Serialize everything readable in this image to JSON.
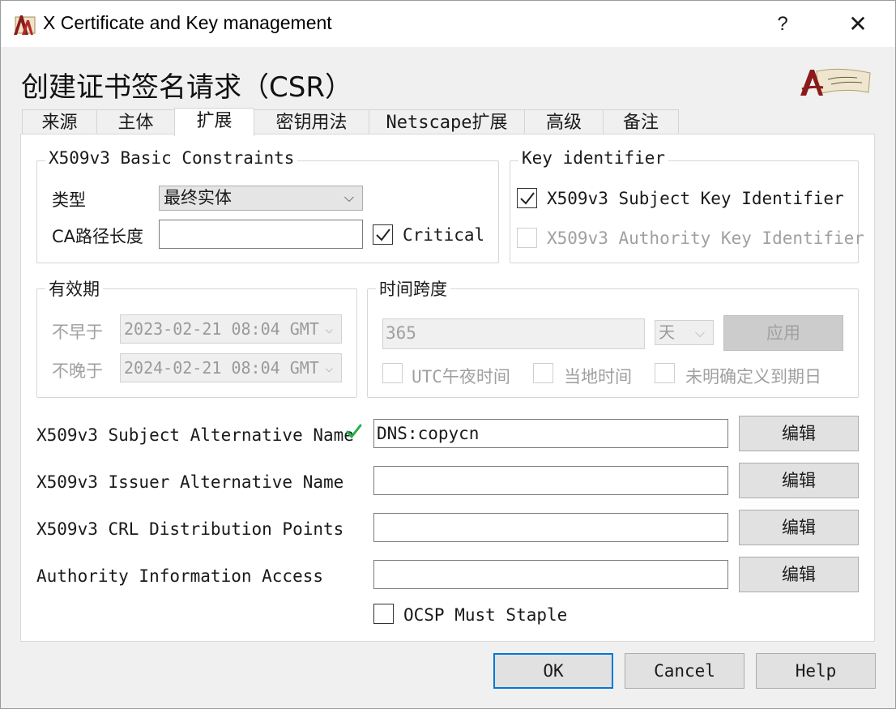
{
  "window": {
    "title": "X Certificate and Key management",
    "help": "?",
    "close": "✕"
  },
  "heading": "创建证书签名请求（CSR）",
  "tabs": [
    "来源",
    "主体",
    "扩展",
    "密钥用法",
    "Netscape扩展",
    "高级",
    "备注"
  ],
  "active_tab": "扩展",
  "basic_constraints": {
    "title": "X509v3 Basic Constraints",
    "type_label": "类型",
    "type_value": "最终实体",
    "path_len_label": "CA路径长度",
    "path_len_value": "",
    "critical_label": "Critical",
    "critical_checked": true
  },
  "key_identifier": {
    "title": "Key identifier",
    "subject_label": "X509v3 Subject Key Identifier",
    "subject_checked": true,
    "authority_label": "X509v3 Authority Key Identifier",
    "authority_checked": false
  },
  "validity": {
    "title": "有效期",
    "not_before_label": "不早于",
    "not_before_value": "2023-02-21 08:04 GMT",
    "not_after_label": "不晚于",
    "not_after_value": "2024-02-21 08:04 GMT"
  },
  "time_range": {
    "title": "时间跨度",
    "amount": "365",
    "unit": "天",
    "apply": "应用",
    "utc_midnight": "UTC午夜时间",
    "local_time": "当地时间",
    "no_end_date": "未明确定义到期日"
  },
  "extensions": [
    {
      "label": "X509v3 Subject Alternative Name",
      "value": "DNS:copycn",
      "edit": "编辑",
      "valid": true
    },
    {
      "label": "X509v3 Issuer Alternative Name",
      "value": "",
      "edit": "编辑",
      "valid": false
    },
    {
      "label": "X509v3 CRL Distribution Points",
      "value": "",
      "edit": "编辑",
      "valid": false
    },
    {
      "label": "Authority Information Access",
      "value": "",
      "edit": "编辑",
      "valid": false
    }
  ],
  "ocsp": {
    "label": "OCSP Must Staple",
    "checked": false
  },
  "footer": {
    "ok": "OK",
    "cancel": "Cancel",
    "help": "Help"
  },
  "colors": {
    "accent": "#0078d7",
    "check_green": "#22b14c"
  }
}
